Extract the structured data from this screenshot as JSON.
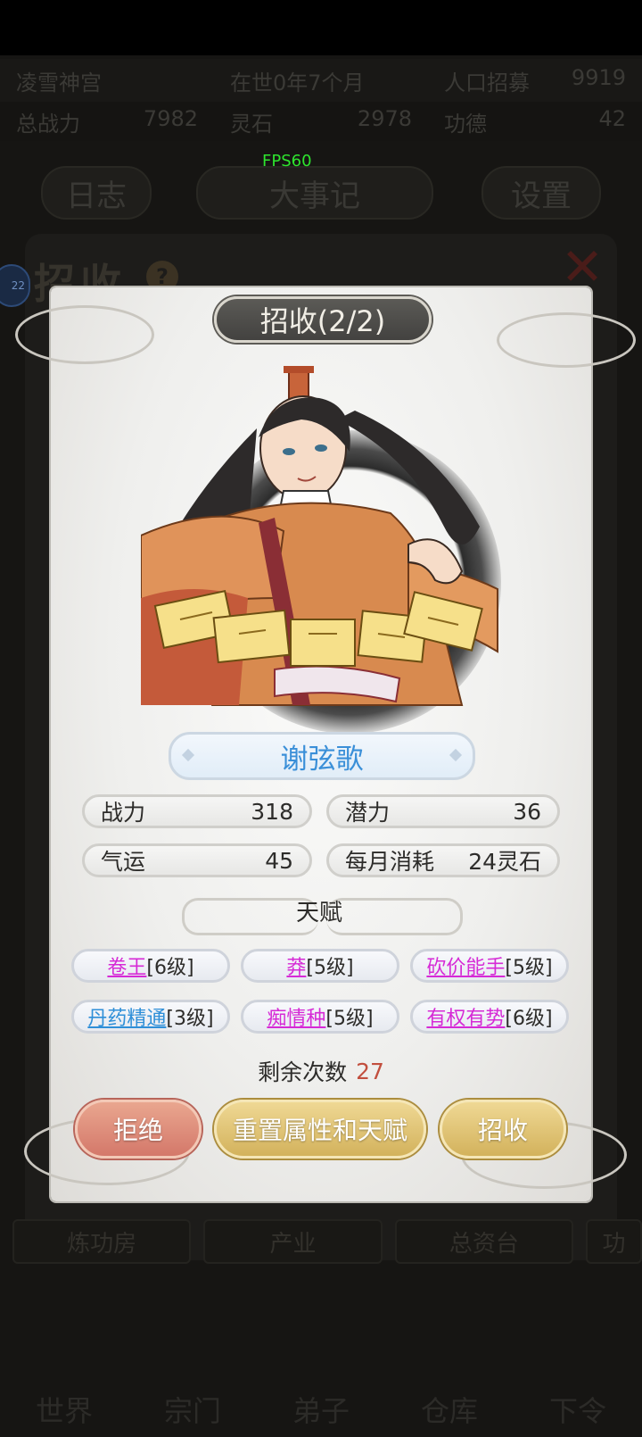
{
  "background": {
    "row1": [
      "凌雪神宫",
      "在世0年7个月",
      "人口招募",
      "9919"
    ],
    "row2": [
      "总战力",
      "7982",
      "灵石",
      "2978",
      "功德",
      "42"
    ],
    "top_buttons": [
      "日志",
      "大事记",
      "设置"
    ],
    "panel_title": "招收",
    "help_icon": "?",
    "badge": "22",
    "tabs": [
      "炼功房",
      "产业",
      "总资台",
      "功"
    ],
    "bottom_nav": [
      "世界",
      "宗门",
      "弟子",
      "仓库",
      "下令"
    ]
  },
  "fps_label": "FPS60",
  "dialog": {
    "title": "招收(2/2)",
    "name": "谢弦歌",
    "stats": [
      {
        "label": "战力",
        "value": "318"
      },
      {
        "label": "潜力",
        "value": "36"
      },
      {
        "label": "气运",
        "value": "45"
      },
      {
        "label": "每月消耗",
        "value": "24灵石"
      }
    ],
    "talent_header": "天赋",
    "talents": [
      {
        "name": "卷王",
        "level": "[6级]",
        "color": "#d62ad6"
      },
      {
        "name": "莽",
        "level": "[5级]",
        "color": "#d62ad6"
      },
      {
        "name": "砍价能手",
        "level": "[5级]",
        "color": "#d62ad6"
      },
      {
        "name": "丹药精通",
        "level": "[3级]",
        "color": "#2f8fd8"
      },
      {
        "name": "痴情种",
        "level": "[5级]",
        "color": "#d62ad6"
      },
      {
        "name": "有权有势",
        "level": "[6级]",
        "color": "#d62ad6"
      }
    ],
    "remaining_label": "剩余次数",
    "remaining_count": "27",
    "buttons": {
      "reject": "拒绝",
      "reset": "重置属性和天赋",
      "recruit": "招收"
    }
  }
}
